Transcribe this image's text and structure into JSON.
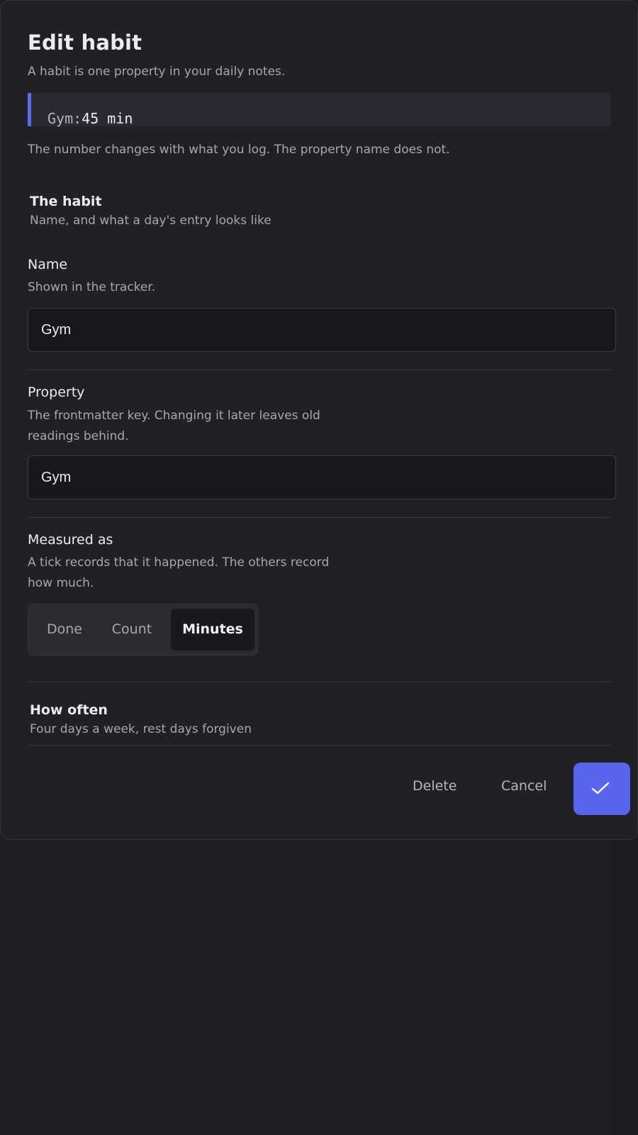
{
  "dialog": {
    "title": "Edit habit",
    "subtitle": "A habit is one property in your daily notes.",
    "example": {
      "key": "Gym:",
      "value": "45 min"
    },
    "note": "The number changes with what you log. The property name does not."
  },
  "habit_section": {
    "title": "The habit",
    "description": "Name, and what a day's entry looks like"
  },
  "name_field": {
    "label": "Name",
    "description": "Shown in the tracker.",
    "value": "Gym"
  },
  "property_field": {
    "label": "Property",
    "description": "The frontmatter key. Changing it later leaves old readings behind.",
    "value": "Gym"
  },
  "measured_field": {
    "label": "Measured as",
    "description": "A tick records that it happened. The others record how much.",
    "options": [
      "Done",
      "Count",
      "Minutes"
    ],
    "selected": "Minutes"
  },
  "frequency_section": {
    "title": "How often",
    "description": "Four days a week, rest days forgiven"
  },
  "actions": {
    "delete_label": "Delete",
    "cancel_label": "Cancel",
    "confirm_icon": "check-icon"
  },
  "colors": {
    "accent": "#5766ec",
    "background": "#202126",
    "input_background": "#17181c"
  }
}
